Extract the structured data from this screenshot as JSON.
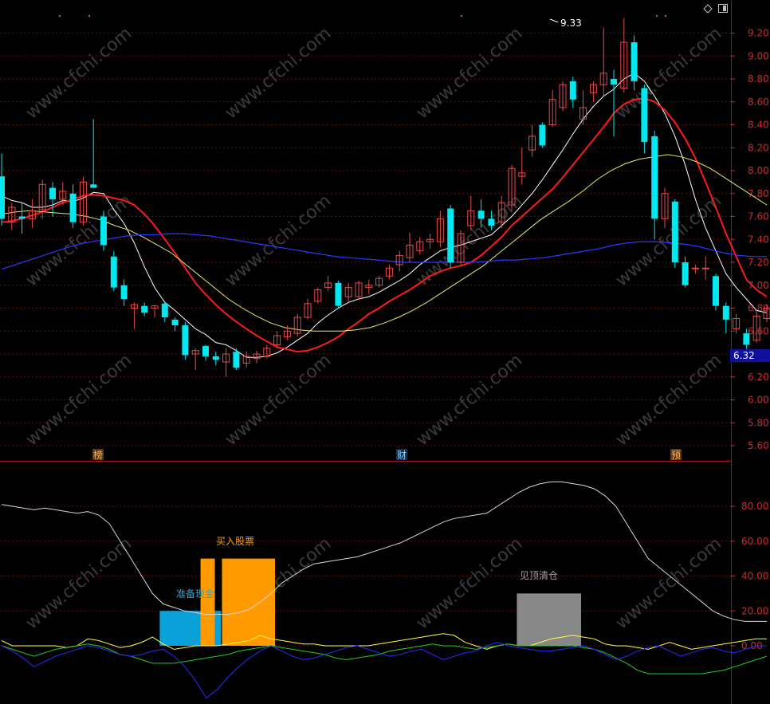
{
  "colors": {
    "background": "#000000",
    "grid": "#6a1010",
    "axis_text": "#cc2b2b",
    "up_candle": "#e84a4a",
    "down_candle": "#00e8f0",
    "ma5": "#ffffff",
    "ma10": "#ff1a1a",
    "ma30": "#e8e870",
    "ma60": "#2a3aff",
    "price_tag_bg": "#1010a0",
    "buy_bar": "#ff9a00",
    "cash_bar": "#0aa0d8",
    "sell_bar": "#888888"
  },
  "icons": [
    "diamond-icon",
    "window-icon"
  ],
  "watermark": "www.cfchi.com",
  "chart_data": [
    {
      "type": "candlestick",
      "ylim": [
        5.5,
        9.4
      ],
      "yticks": [
        "9.20",
        "9.00",
        "8.80",
        "8.60",
        "8.40",
        "8.20",
        "8.00",
        "7.80",
        "7.60",
        "7.40",
        "7.20",
        "7.00",
        "6.80",
        "6.60",
        "6.40",
        "6.20",
        "6.00",
        "5.80",
        "5.60"
      ],
      "current_price": "6.32",
      "high_label": "9.33",
      "markers": [
        "榜",
        "财",
        "预"
      ],
      "candles": [
        [
          7.95,
          7.58,
          8.15,
          7.52
        ],
        [
          7.55,
          7.68,
          7.72,
          7.48
        ],
        [
          7.6,
          7.58,
          7.72,
          7.45
        ],
        [
          7.58,
          7.65,
          7.75,
          7.5
        ],
        [
          7.66,
          7.88,
          7.92,
          7.58
        ],
        [
          7.85,
          7.75,
          7.9,
          7.6
        ],
        [
          7.75,
          7.82,
          7.9,
          7.7
        ],
        [
          7.8,
          7.55,
          7.88,
          7.5
        ],
        [
          7.55,
          7.9,
          7.95,
          7.52
        ],
        [
          7.88,
          7.85,
          8.45,
          7.85
        ],
        [
          7.6,
          7.35,
          7.65,
          7.3
        ],
        [
          7.25,
          6.98,
          7.3,
          6.95
        ],
        [
          7.0,
          6.88,
          7.05,
          6.82
        ],
        [
          6.8,
          6.83,
          6.85,
          6.62
        ],
        [
          6.82,
          6.76,
          6.85,
          6.73
        ],
        [
          6.8,
          6.82,
          6.83,
          6.72
        ],
        [
          6.84,
          6.72,
          6.85,
          6.68
        ],
        [
          6.7,
          6.65,
          6.72,
          6.6
        ],
        [
          6.65,
          6.39,
          6.68,
          6.35
        ],
        [
          6.4,
          6.43,
          6.45,
          6.26
        ],
        [
          6.47,
          6.38,
          6.48,
          6.34
        ],
        [
          6.38,
          6.35,
          6.42,
          6.3
        ],
        [
          6.33,
          6.4,
          6.45,
          6.2
        ],
        [
          6.42,
          6.28,
          6.45,
          6.26
        ],
        [
          6.32,
          6.38,
          6.42,
          6.28
        ],
        [
          6.36,
          6.4,
          6.43,
          6.32
        ],
        [
          6.38,
          6.45,
          6.48,
          6.36
        ],
        [
          6.48,
          6.56,
          6.6,
          6.45
        ],
        [
          6.55,
          6.6,
          6.65,
          6.52
        ],
        [
          6.58,
          6.72,
          6.75,
          6.55
        ],
        [
          6.72,
          6.84,
          6.88,
          6.7
        ],
        [
          6.86,
          6.96,
          6.98,
          6.84
        ],
        [
          6.98,
          7.02,
          7.08,
          6.95
        ],
        [
          7.02,
          6.82,
          7.04,
          6.8
        ],
        [
          6.9,
          6.98,
          7.02,
          6.85
        ],
        [
          6.9,
          7.02,
          7.04,
          6.88
        ],
        [
          6.98,
          7.0,
          7.05,
          6.92
        ],
        [
          7.0,
          7.06,
          7.08,
          6.98
        ],
        [
          7.08,
          7.15,
          7.18,
          7.05
        ],
        [
          7.18,
          7.26,
          7.3,
          7.12
        ],
        [
          7.24,
          7.35,
          7.46,
          7.2
        ],
        [
          7.3,
          7.38,
          7.42,
          7.27
        ],
        [
          7.38,
          7.4,
          7.45,
          7.32
        ],
        [
          7.38,
          7.58,
          7.65,
          7.33
        ],
        [
          7.67,
          7.2,
          7.7,
          7.15
        ],
        [
          7.2,
          7.45,
          7.48,
          7.18
        ],
        [
          7.52,
          7.65,
          7.78,
          7.48
        ],
        [
          7.65,
          7.58,
          7.75,
          7.5
        ],
        [
          7.58,
          7.52,
          7.65,
          7.48
        ],
        [
          7.55,
          7.72,
          7.78,
          7.5
        ],
        [
          7.7,
          8.02,
          8.05,
          7.65
        ],
        [
          7.95,
          7.98,
          8.2,
          7.88
        ],
        [
          8.18,
          8.3,
          8.4,
          8.12
        ],
        [
          8.4,
          8.22,
          8.42,
          8.2
        ],
        [
          8.4,
          8.62,
          8.7,
          8.38
        ],
        [
          8.55,
          8.75,
          8.78,
          8.52
        ],
        [
          8.78,
          8.62,
          8.82,
          8.55
        ],
        [
          8.45,
          8.55,
          8.7,
          8.4
        ],
        [
          8.68,
          8.75,
          8.78,
          8.6
        ],
        [
          8.75,
          8.85,
          9.25,
          8.65
        ],
        [
          8.8,
          8.75,
          8.88,
          8.3
        ],
        [
          8.72,
          9.12,
          9.33,
          8.68
        ],
        [
          9.12,
          8.78,
          9.18,
          8.7
        ],
        [
          8.72,
          8.25,
          8.75,
          8.15
        ],
        [
          8.3,
          7.58,
          8.35,
          7.4
        ],
        [
          7.58,
          7.8,
          7.85,
          7.5
        ],
        [
          7.73,
          7.2,
          7.75,
          7.15
        ],
        [
          7.2,
          7.0,
          7.25,
          6.98
        ],
        [
          7.15,
          7.15,
          7.18,
          7.1
        ],
        [
          7.15,
          7.15,
          7.25,
          7.05
        ],
        [
          7.08,
          6.82,
          7.1,
          6.78
        ],
        [
          6.82,
          6.7,
          6.85,
          6.58
        ],
        [
          6.62,
          6.71,
          6.75,
          6.58
        ],
        [
          6.58,
          6.48,
          6.62,
          6.42
        ],
        [
          6.52,
          6.73,
          6.78,
          6.5
        ],
        [
          6.71,
          6.8,
          6.83,
          6.68
        ]
      ],
      "series": [
        {
          "values": [
            7.78,
            7.74,
            7.72,
            7.68,
            7.68,
            7.7,
            7.74,
            7.73,
            7.76,
            7.81,
            7.8,
            7.66,
            7.54,
            7.37,
            7.16,
            6.98,
            6.85,
            6.78,
            6.7,
            6.62,
            6.57,
            6.5,
            6.48,
            6.43,
            6.37,
            6.37,
            6.38,
            6.41,
            6.46,
            6.52,
            6.58,
            6.67,
            6.74,
            6.8,
            6.85,
            6.88,
            6.9,
            6.94,
            6.99,
            7.04,
            7.1,
            7.18,
            7.24,
            7.3,
            7.33,
            7.35,
            7.38,
            7.41,
            7.44,
            7.52,
            7.6,
            7.7,
            7.8,
            7.92,
            8.05,
            8.18,
            8.32,
            8.45,
            8.56,
            8.65,
            8.71,
            8.8,
            8.85,
            8.78,
            8.65,
            8.5,
            8.3,
            8.05,
            7.75,
            7.5,
            7.3,
            7.1,
            6.98,
            6.88,
            6.78,
            6.76
          ]
        },
        {
          "values": [
            7.55,
            7.56,
            7.58,
            7.61,
            7.64,
            7.68,
            7.72,
            7.75,
            7.78,
            7.79,
            7.78,
            7.76,
            7.74,
            7.7,
            7.62,
            7.52,
            7.4,
            7.28,
            7.15,
            7.02,
            6.92,
            6.83,
            6.75,
            6.68,
            6.62,
            6.56,
            6.51,
            6.46,
            6.44,
            6.42,
            6.43,
            6.46,
            6.5,
            6.55,
            6.62,
            6.68,
            6.75,
            6.8,
            6.86,
            6.91,
            6.96,
            7.02,
            7.08,
            7.12,
            7.15,
            7.17,
            7.2,
            7.26,
            7.34,
            7.42,
            7.52,
            7.6,
            7.68,
            7.76,
            7.84,
            7.94,
            8.05,
            8.16,
            8.27,
            8.38,
            8.5,
            8.58,
            8.62,
            8.63,
            8.6,
            8.53,
            8.42,
            8.28,
            8.11,
            7.9,
            7.68,
            7.45,
            7.25,
            7.05,
            6.96,
            6.9
          ]
        },
        {
          "values": [
            7.62,
            7.64,
            7.65,
            7.64,
            7.63,
            7.62,
            7.6,
            7.57,
            7.52,
            7.48,
            7.42,
            7.35,
            7.28,
            7.18,
            7.08,
            6.98,
            6.88,
            6.8,
            6.73,
            6.67,
            6.63,
            6.61,
            6.6,
            6.6,
            6.6,
            6.61,
            6.63,
            6.67,
            6.72,
            6.78,
            6.85,
            6.93,
            7.01,
            7.09,
            7.17,
            7.27,
            7.37,
            7.47,
            7.57,
            7.65,
            7.73,
            7.82,
            7.92,
            8.0,
            8.06,
            8.1,
            8.12,
            8.14,
            8.12,
            8.08,
            8.02,
            7.94,
            7.86,
            7.78,
            7.7
          ]
        },
        {
          "values": [
            7.14,
            7.18,
            7.22,
            7.26,
            7.3,
            7.34,
            7.37,
            7.39,
            7.41,
            7.43,
            7.44,
            7.44,
            7.45,
            7.45,
            7.44,
            7.43,
            7.41,
            7.39,
            7.37,
            7.35,
            7.33,
            7.31,
            7.29,
            7.27,
            7.25,
            7.24,
            7.23,
            7.22,
            7.21,
            7.2,
            7.2,
            7.2,
            7.2,
            7.2,
            7.2,
            7.21,
            7.22,
            7.22,
            7.23,
            7.24,
            7.26,
            7.28,
            7.3,
            7.32,
            7.35,
            7.37,
            7.38,
            7.38,
            7.37,
            7.36,
            7.34,
            7.31,
            7.28,
            7.26,
            7.25,
            7.25
          ]
        }
      ]
    },
    {
      "type": "line+bar",
      "ylim": [
        -25,
        95
      ],
      "yticks": [
        "80.00",
        "60.00",
        "40.00",
        "20.00",
        "0.00"
      ],
      "labels": {
        "cash": "准备现金",
        "buy": "买入股票",
        "sell": "见顶清仓"
      },
      "bars": [
        {
          "kind": "cash",
          "x0": 15.5,
          "x1": 21.5,
          "value": 20
        },
        {
          "kind": "buy",
          "x0": 19.5,
          "x1": 20.9,
          "value": 50
        },
        {
          "kind": "buy",
          "x0": 21.6,
          "x1": 26.8,
          "value": 50
        },
        {
          "kind": "sell",
          "x0": 50.5,
          "x1": 56.8,
          "value": 30
        }
      ],
      "series": [
        {
          "values": [
            81,
            80,
            79,
            78,
            79,
            78,
            77,
            76,
            77,
            75,
            70,
            60,
            50,
            40,
            30,
            24,
            22,
            20,
            19,
            18,
            18,
            18,
            19,
            21,
            25,
            30,
            36,
            40,
            44,
            47,
            48,
            49,
            50,
            51,
            53,
            55,
            57,
            59,
            62,
            65,
            68,
            71,
            73,
            74,
            75,
            76,
            80,
            84,
            88,
            91,
            93,
            94,
            94,
            93,
            92,
            90,
            86,
            80,
            70,
            60,
            50,
            45,
            40,
            35,
            30,
            25,
            20,
            17,
            15,
            14,
            14,
            14
          ]
        },
        {
          "values": [
            3,
            0,
            0,
            0,
            0,
            0,
            -1,
            0,
            4,
            3,
            1,
            -1,
            0,
            2,
            5,
            1,
            -2,
            -1,
            0,
            0,
            0,
            1,
            2,
            3,
            6,
            4,
            3,
            2,
            1,
            1,
            0,
            0,
            0,
            0,
            0,
            1,
            2,
            3,
            4,
            5,
            6,
            7,
            6,
            2,
            0,
            -2,
            0,
            1,
            0,
            0,
            2,
            4,
            5,
            6,
            5,
            4,
            1,
            0,
            0,
            -1,
            -2,
            0,
            2,
            0,
            -2,
            -1,
            0,
            1,
            2,
            3,
            4,
            4
          ]
        },
        {
          "values": [
            0,
            -2,
            -4,
            -6,
            -4,
            -2,
            -1,
            0,
            1,
            0,
            -2,
            -5,
            -6,
            -8,
            -10,
            -10,
            -10,
            -9,
            -8,
            -7,
            -6,
            -5,
            -3,
            -2,
            -1,
            0,
            -1,
            -2,
            -3,
            -4,
            -5,
            -7,
            -8,
            -7,
            -6,
            -5,
            -3,
            -2,
            -1,
            0,
            1,
            0,
            0,
            -1,
            -2,
            -1,
            0,
            1,
            0,
            0,
            0,
            0,
            0,
            0,
            -1,
            -2,
            -4,
            -7,
            -10,
            -14,
            -16,
            -16,
            -16,
            -16,
            -16,
            -16,
            -15,
            -14,
            -12,
            -10,
            -8,
            -6
          ]
        },
        {
          "values": [
            0,
            -3,
            -7,
            -12,
            -9,
            -6,
            -4,
            -2,
            0,
            -1,
            -3,
            -5,
            -6,
            -5,
            -3,
            -2,
            -6,
            -12,
            -20,
            -30,
            -25,
            -18,
            -12,
            -7,
            -3,
            0,
            -3,
            -6,
            -8,
            -7,
            -5,
            -3,
            -1,
            0,
            -2,
            -4,
            -6,
            -5,
            -3,
            -2,
            -5,
            -8,
            -6,
            -4,
            -3,
            0,
            2,
            0,
            -1,
            -2,
            -3,
            -3,
            -2,
            -1,
            0,
            -2,
            -5,
            -8,
            -6,
            -3,
            -1,
            0,
            -3,
            -6,
            -4,
            -2,
            -1,
            -3,
            -4,
            -2,
            0,
            0
          ]
        }
      ]
    }
  ]
}
